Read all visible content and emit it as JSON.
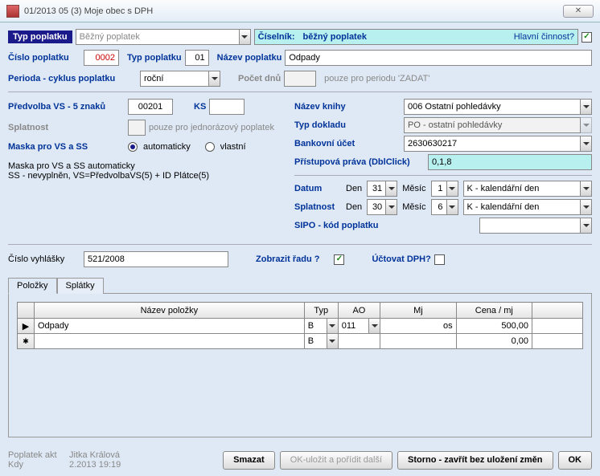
{
  "title": "01/2013  05  (3)  Moje obec s DPH",
  "closeGlyph": "✕",
  "row1": {
    "typPoplatku_lbl": "Typ poplatku",
    "typPoplatku_val": "Běžný poplatek",
    "ciselnik_lbl": "Číselník:",
    "ciselnik_val": "běžný poplatek",
    "hlavni_lbl": "Hlavní činnost?"
  },
  "row2": {
    "cislo_lbl": "Číslo poplatku",
    "cislo_val": "0002",
    "typ_lbl": "Typ poplatku",
    "typ_val": "01",
    "nazev_lbl": "Název poplatku",
    "nazev_val": "Odpady"
  },
  "row3": {
    "perioda_lbl": "Perioda - cyklus poplatku",
    "perioda_val": "roční",
    "pocet_lbl": "Počet dnů",
    "pouze_txt": "pouze pro periodu 'ZADAT'"
  },
  "left": {
    "predvolba_lbl": "Předvolba VS - 5 znaků",
    "predvolba_val": "00201",
    "ks_lbl": "KS",
    "ks_val": "",
    "splatnost_lbl": "Splatnost",
    "splatnost_note": "pouze pro jednorázový poplatek",
    "maska_lbl": "Maska pro VS a SS",
    "r_auto": "automaticky",
    "r_vlastni": "vlastní",
    "desc1": "Maska pro VS a SS automaticky",
    "desc2": "SS - nevyplněn, VS=PředvolbaVS(5) + ID Plátce(5)"
  },
  "right": {
    "nazevKnihy_lbl": "Název knihy",
    "nazevKnihy_val": "006  Ostatní pohledávky",
    "typDokladu_lbl": "Typ dokladu",
    "typDokladu_val": "PO - ostatní pohledávky",
    "bankUcet_lbl": "Bankovní účet",
    "bankUcet_val": "2630630217",
    "prava_lbl": "Přístupová práva (DblClick)",
    "prava_val": "0,1,8",
    "datum_lbl": "Datum",
    "splatn_lbl": "Splatnost",
    "den_lbl": "Den",
    "mesic_lbl": "Měsíc",
    "datum_den": "31",
    "datum_mes": "1",
    "splat_den": "30",
    "splat_mes": "6",
    "kal": "K - kalendářní den",
    "sipo_lbl": "SIPO - kód poplatku"
  },
  "row4": {
    "vyhlaska_lbl": "Číslo vyhlášky",
    "vyhlaska_val": "521/2008",
    "zobrazit_lbl": "Zobrazit řadu ?",
    "uctovat_lbl": "Účtovat DPH?"
  },
  "tabs": {
    "polozky": "Položky",
    "splatky": "Splátky"
  },
  "grid": {
    "h_nazev": "Název položky",
    "h_typ": "Typ",
    "h_ao": "AO",
    "h_mj": "Mj",
    "h_cena": "Cena / mj",
    "r1_nazev": "Odpady",
    "r1_typ": "B",
    "r1_ao": "011",
    "r1_mj": "os",
    "r1_cena": "500,00",
    "r2_typ": "B",
    "r2_cena": "0,00",
    "arrow": "▶",
    "star": "✱"
  },
  "footer": {
    "akt_lbl": "Poplatek akt",
    "akt_val": "Jitka Králová",
    "kdy_lbl": "Kdy",
    "kdy_val": "2.2013 19:19",
    "smazat": "Smazat",
    "okdalsi": "OK-uložit a pořídit další",
    "storno": "Storno - zavřít  bez uložení změn",
    "ok": "OK"
  }
}
